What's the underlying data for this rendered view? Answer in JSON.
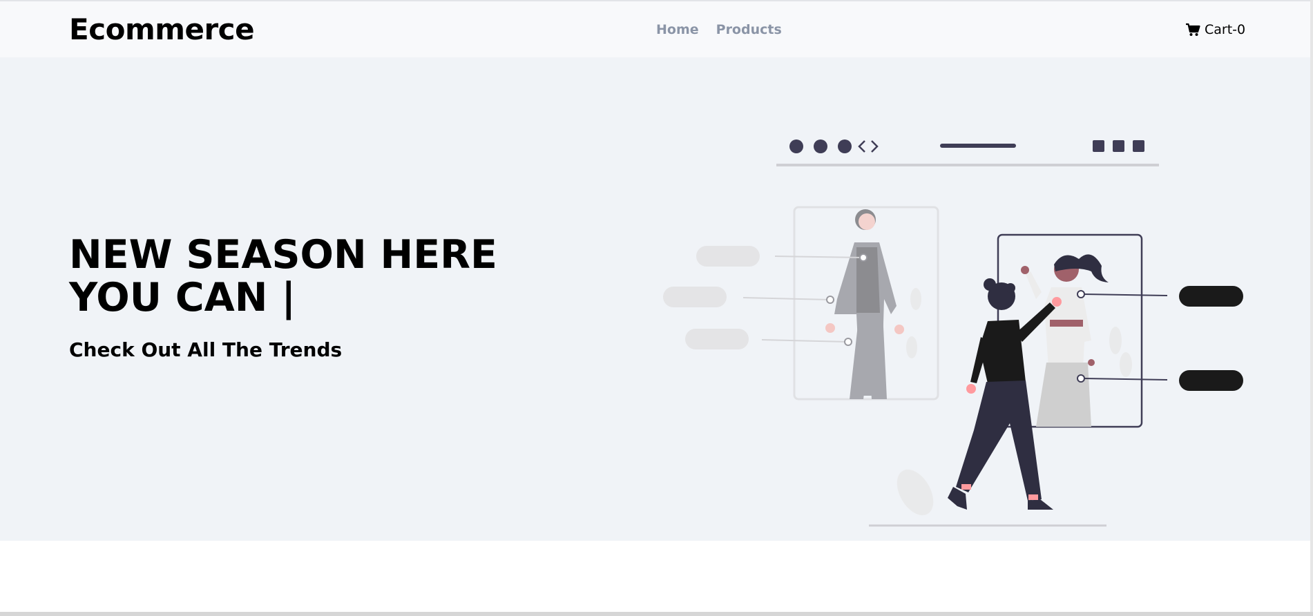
{
  "navbar": {
    "brand": "Ecommerce",
    "links": [
      {
        "label": "Home"
      },
      {
        "label": "Products"
      }
    ],
    "cart": {
      "icon": "cart-icon",
      "label": "Cart-0"
    }
  },
  "hero": {
    "title": "NEW SEASON HERE YOU CAN |",
    "subtitle": "Check Out All The Trends",
    "illustration": "woman-choosing-outfits-illustration"
  },
  "colors": {
    "navbar_bg": "#f8f9fb",
    "hero_bg": "#f0f3f7",
    "nav_link": "#8a94a6",
    "illustration_dark": "#3f3d56",
    "pill_dark": "#1a1a1a"
  }
}
